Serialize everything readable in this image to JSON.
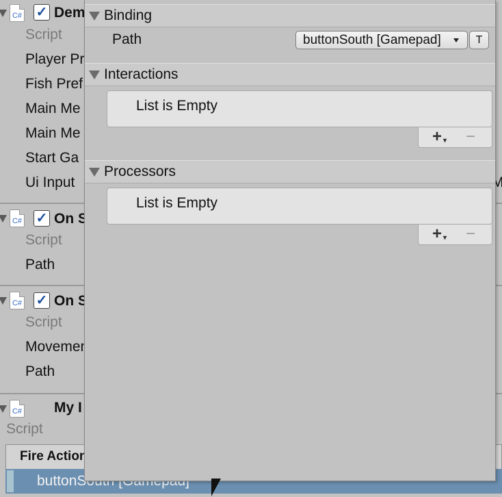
{
  "inspector": {
    "component1": {
      "title": "Dem",
      "fields": [
        "Script",
        "Player Pr",
        "Fish Pref",
        "Main Me",
        "Main Me",
        "Start Ga",
        "Ui Input"
      ]
    },
    "component2": {
      "title": "On S",
      "fields": [
        "Script",
        "Path"
      ]
    },
    "component3": {
      "title": "On S",
      "fields": [
        "Script",
        "Movemen",
        "Path"
      ]
    },
    "component4": {
      "title": "My I",
      "fields": [
        "Script"
      ]
    },
    "fire_list": {
      "header": "Fire Action",
      "row": "buttonSouth [Gamepad]"
    },
    "icon_label": "C#",
    "right_edge_text": "M"
  },
  "popup": {
    "binding": {
      "title": "Binding",
      "path_label": "Path",
      "path_value": "buttonSouth [Gamepad]",
      "t_button": "T"
    },
    "interactions": {
      "title": "Interactions",
      "empty_text": "List is Empty",
      "add": "+",
      "remove": "−"
    },
    "processors": {
      "title": "Processors",
      "empty_text": "List is Empty",
      "add": "+",
      "remove": "−"
    }
  }
}
